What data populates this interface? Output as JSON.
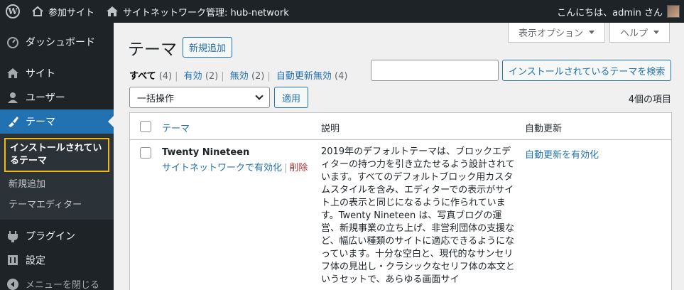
{
  "adminbar": {
    "site_name": "参加サイト",
    "network_admin": "サイトネットワーク管理: hub-network",
    "greeting": "こんにちは、admin さん"
  },
  "sidebar": {
    "items": [
      {
        "label": "ダッシュボード",
        "icon": "gauge-icon"
      },
      {
        "label": "サイト",
        "icon": "home-icon"
      },
      {
        "label": "ユーザー",
        "icon": "user-icon"
      },
      {
        "label": "テーマ",
        "icon": "brush-icon"
      }
    ],
    "submenu": [
      "インストールされているテーマ",
      "新規追加",
      "テーマエディター"
    ],
    "after": [
      {
        "label": "プラグイン",
        "icon": "plug-icon"
      },
      {
        "label": "設定",
        "icon": "settings-icon"
      }
    ],
    "collapse": "メニューを閉じる"
  },
  "screen_options": "表示オプション",
  "help": "ヘルプ",
  "page": {
    "title": "テーマ",
    "add_new": "新規追加",
    "filters": {
      "all": "すべて",
      "all_count": "(4)",
      "enabled": "有効",
      "enabled_count": "(2)",
      "disabled": "無効",
      "disabled_count": "(2)",
      "auto_off": "自動更新無効",
      "auto_off_count": "(4)"
    },
    "search_button": "インストールされているテーマを検索",
    "bulk_action": "一括操作",
    "apply": "適用",
    "items_count": "4個の項目"
  },
  "table": {
    "headers": {
      "theme": "テーマ",
      "description": "説明",
      "auto_update": "自動更新"
    },
    "rows": [
      {
        "name": "Twenty Nineteen",
        "activate": "サイトネットワークで有効化",
        "delete": "削除",
        "description": "2019年のデフォルトテーマは、ブロックエディターの持つ力を引き立たせるよう設計されています。すべてのデフォルトブロック用カスタムスタイルを含み、エディターでの表示がサイト上の表示と同じになるように作られています。Twenty Nineteen は、写真ブログの運営、新規事業の立ち上げ、非営利団体の支援など、幅広い種類のサイトに適応できるようになっています。十分な空白と、現代的なサンセリフ体の見出し・クラシックなセリフ体の本文というセットで、あらゆる画面サイ",
        "auto_update": "自動更新を有効化"
      }
    ]
  }
}
